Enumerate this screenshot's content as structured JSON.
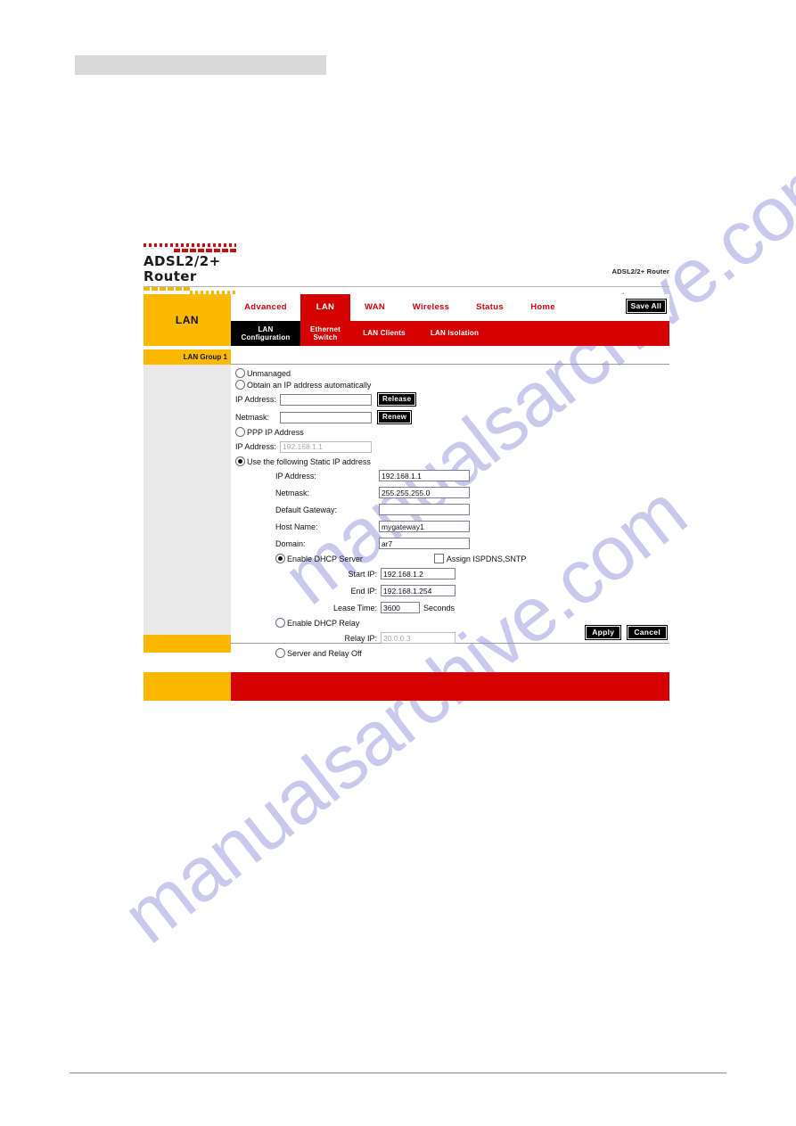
{
  "watermark": {
    "line1": "manualsarchive.com",
    "line2": "manualsarchive.com",
    "color": "#c9c9ee"
  },
  "header": {
    "logo_text": "ADSL2/2+ Router",
    "right_label": "ADSL2/2+ Router"
  },
  "nav": {
    "side_label": "LAN",
    "save_all_label": "Save All",
    "tabs": [
      {
        "label": "Advanced",
        "active": false
      },
      {
        "label": "LAN",
        "active": true
      },
      {
        "label": "WAN",
        "active": false
      },
      {
        "label": "Wireless",
        "active": false
      },
      {
        "label": "Status",
        "active": false
      },
      {
        "label": "Home",
        "active": false
      }
    ],
    "subtabs": [
      {
        "line1": "LAN",
        "line2": "Configuration",
        "active": true
      },
      {
        "line1": "Ethernet",
        "line2": "Switch",
        "active": false
      },
      {
        "line1": "LAN Clients",
        "line2": "",
        "active": false
      },
      {
        "line1": "LAN Isolation",
        "line2": "",
        "active": false
      }
    ]
  },
  "panel": {
    "group_tab_label": "LAN Group 1"
  },
  "form": {
    "unmanaged_label": "Unmanaged",
    "obtain_auto_label": "Obtain an IP address automatically",
    "dhcp_ip_label": "IP Address:",
    "dhcp_ip_value": "",
    "release_button": "Release",
    "dhcp_netmask_label": "Netmask:",
    "dhcp_netmask_value": "",
    "renew_button": "Renew",
    "ppp_ip_label": "PPP IP Address",
    "ppp_ip_field_label": "IP Address:",
    "ppp_ip_field_value": "192.168.1.1",
    "static_label": "Use the following Static IP address",
    "static": {
      "ip_label": "IP Address:",
      "ip_value": "192.168.1.1",
      "netmask_label": "Netmask:",
      "netmask_value": "255.255.255.0",
      "gateway_label": "Default Gateway:",
      "gateway_value": "",
      "hostname_label": "Host Name:",
      "hostname_value": "mygateway1",
      "domain_label": "Domain:",
      "domain_value": "ar7"
    },
    "dhcp_server_label": "Enable DHCP Server",
    "assign_label": "Assign ISPDNS,SNTP",
    "start_ip_label": "Start IP:",
    "start_ip_value": "192.168.1.2",
    "end_ip_label": "End IP:",
    "end_ip_value": "192.168.1.254",
    "lease_time_label": "Lease Time:",
    "lease_time_value": "3600",
    "lease_time_suffix": "Seconds",
    "dhcp_relay_label": "Enable DHCP Relay",
    "relay_ip_label": "Relay IP:",
    "relay_ip_value": "20.0.0.3",
    "server_relay_off_label": "Server and Relay Off"
  },
  "footer": {
    "apply_label": "Apply",
    "cancel_label": "Cancel"
  },
  "colors": {
    "red": "#d40000",
    "yellow": "#fcb900",
    "black": "#000000",
    "grey_panel": "#e9e9e9"
  }
}
